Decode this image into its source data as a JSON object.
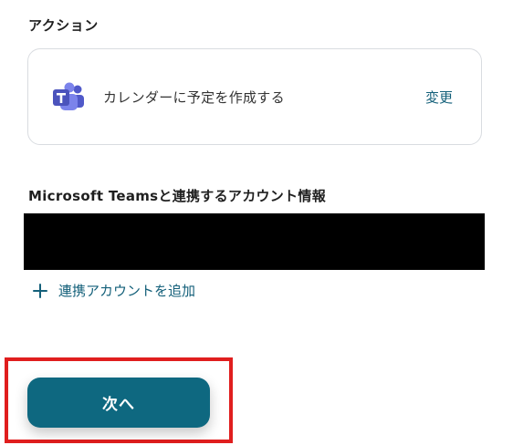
{
  "section": {
    "title": "アクション"
  },
  "action": {
    "app_icon": "microsoft-teams-icon",
    "label": "カレンダーに予定を作成する",
    "change_label": "変更"
  },
  "account": {
    "title": "Microsoft Teamsと連携するアカウント情報",
    "value": ""
  },
  "add_account": {
    "icon": "plus-icon",
    "label": "連携アカウントを追加"
  },
  "next_button": {
    "label": "次へ"
  },
  "colors": {
    "accent": "#14607a",
    "button": "#0e6880",
    "highlight": "#e01e1e",
    "redacted": "#000000"
  }
}
